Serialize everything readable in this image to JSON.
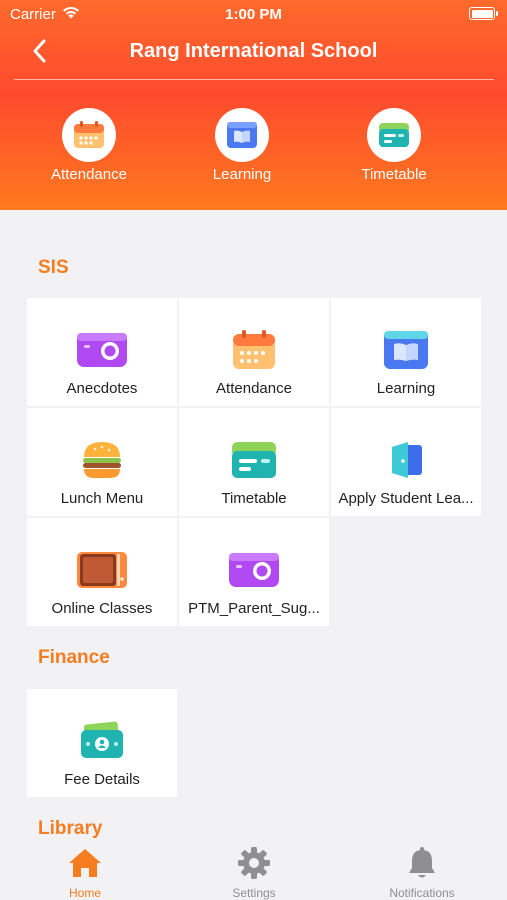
{
  "status_bar": {
    "carrier": "Carrier",
    "time": "1:00 PM"
  },
  "nav": {
    "title": "Rang International School"
  },
  "quick_access": [
    {
      "label": "Attendance",
      "icon": "calendar-icon"
    },
    {
      "label": "Learning",
      "icon": "book-icon"
    },
    {
      "label": "Timetable",
      "icon": "timetable-icon"
    }
  ],
  "sections": {
    "sis": {
      "title": "SIS",
      "items": [
        {
          "label": "Anecdotes",
          "icon": "camera-icon"
        },
        {
          "label": "Attendance",
          "icon": "calendar-icon"
        },
        {
          "label": "Learning",
          "icon": "book-icon"
        },
        {
          "label": "Lunch Menu",
          "icon": "burger-icon"
        },
        {
          "label": "Timetable",
          "icon": "timetable-icon"
        },
        {
          "label": "Apply Student Lea...",
          "icon": "door-icon"
        },
        {
          "label": "Online Classes",
          "icon": "classroom-icon"
        },
        {
          "label": "PTM_Parent_Sug...",
          "icon": "camera-icon"
        }
      ]
    },
    "finance": {
      "title": "Finance",
      "items": [
        {
          "label": "Fee Details",
          "icon": "money-icon"
        }
      ]
    },
    "library": {
      "title": "Library"
    }
  },
  "tabs": [
    {
      "label": "Home",
      "icon": "home-icon",
      "active": true
    },
    {
      "label": "Settings",
      "icon": "gear-icon",
      "active": false
    },
    {
      "label": "Notifications",
      "icon": "bell-icon",
      "active": false
    }
  ],
  "colors": {
    "accent": "#f57c1f",
    "header_top": "#ff6a2b",
    "header_bottom": "#ff7a1e",
    "inactive": "#8e8e93"
  }
}
